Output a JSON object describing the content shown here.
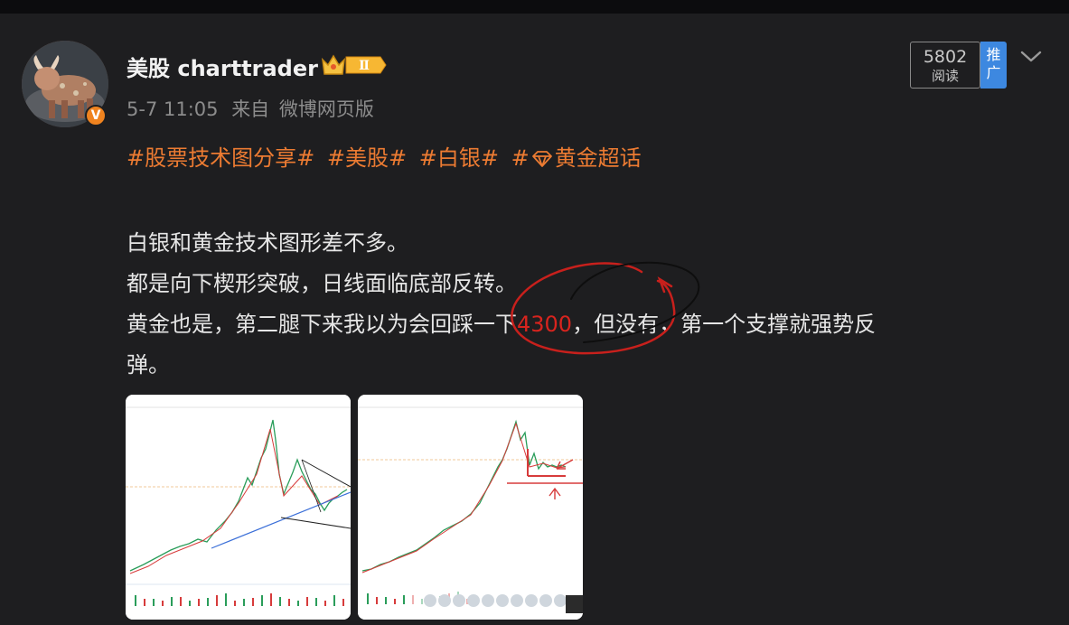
{
  "post": {
    "username": "美股 charttrader",
    "level_badge": "Ⅱ",
    "verified_badge": "V",
    "timestamp": "5-7 11:05",
    "source_prefix": "来自",
    "source": "微博网页版",
    "read_count": "5802",
    "read_label": "阅读",
    "promote_label": "推广"
  },
  "tags": [
    "#股票技术图分享#",
    "#美股#",
    "#白银#",
    "黄金超话"
  ],
  "tag_hash": "#",
  "body": {
    "line1": "白银和黄金技术图形差不多。",
    "line2": "都是向下楔形突破，日线面临底部反转。",
    "line3_before": "黄金也是，第二腿下来我以为会回踩一下",
    "line3_highlight": "4300",
    "line3_after": "，但没有，第一个支撑就强势反",
    "line4": "弹。"
  },
  "images": [
    {
      "label": "silver-chart-thumbnail"
    },
    {
      "label": "gold-chart-thumbnail"
    }
  ],
  "colors": {
    "accent": "#ec7b32",
    "highlight": "#d8241e",
    "promote": "#3d88e0",
    "verified": "#f0831f"
  },
  "icons": [
    "bull-avatar",
    "crown-icon",
    "gem-icon",
    "chevron-down-icon",
    "verified-icon"
  ]
}
